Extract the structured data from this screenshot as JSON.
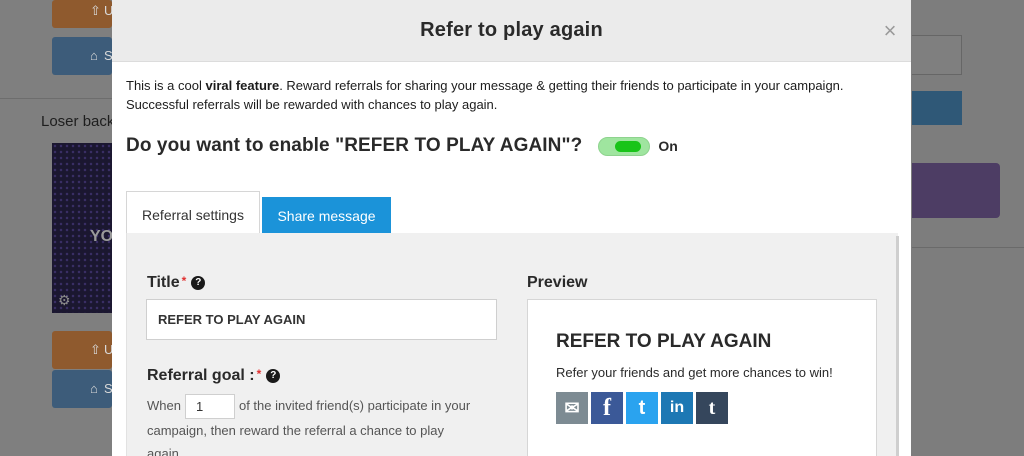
{
  "background": {
    "left_button_labels": [
      "U",
      "Se",
      "U",
      "Se"
    ],
    "loser_label": "Loser back",
    "thumb_text": "YO"
  },
  "modal": {
    "title": "Refer to play again",
    "close_glyph": "×",
    "intro_lead": "This is a cool ",
    "intro_bold": "viral feature",
    "intro_rest": ". Reward referrals for sharing your message & getting their friends to participate in your campaign. Successful referrals will be rewarded with chances to play again.",
    "enable_question": "Do you want to enable \"REFER TO PLAY AGAIN\"?",
    "toggle": {
      "state_label": "On",
      "enabled": true
    },
    "tabs": [
      {
        "label": "Referral settings",
        "active": true
      },
      {
        "label": "Share message",
        "active": false
      }
    ],
    "form": {
      "title_label": "Title",
      "title_value": "REFER TO PLAY AGAIN",
      "goal_label": "Referral goal :",
      "goal_prefix": "When",
      "goal_value": "1",
      "goal_suffix": "of the invited friend(s) participate in your campaign, then reward the referral a chance to play again.",
      "required_mark": "*",
      "help_glyph": "?"
    },
    "preview": {
      "label": "Preview",
      "title": "REFER TO PLAY AGAIN",
      "text": "Refer your friends and get more chances to win!",
      "share_buttons": [
        {
          "name": "email-icon",
          "glyph": "✉",
          "color": "#7d8b93"
        },
        {
          "name": "facebook-icon",
          "glyph": "f",
          "color": "#3b5998"
        },
        {
          "name": "twitter-icon",
          "glyph": "t",
          "color": "#2aa3ef"
        },
        {
          "name": "linkedin-icon",
          "glyph": "in",
          "color": "#1d78b4"
        },
        {
          "name": "tumblr-icon",
          "glyph": "t",
          "color": "#35465c"
        }
      ]
    }
  },
  "colors": {
    "tab_active_bg": "#ffffff",
    "tab_inactive_bg": "#1b93d9",
    "toggle_on": "#18c418",
    "required": "#e03030"
  }
}
